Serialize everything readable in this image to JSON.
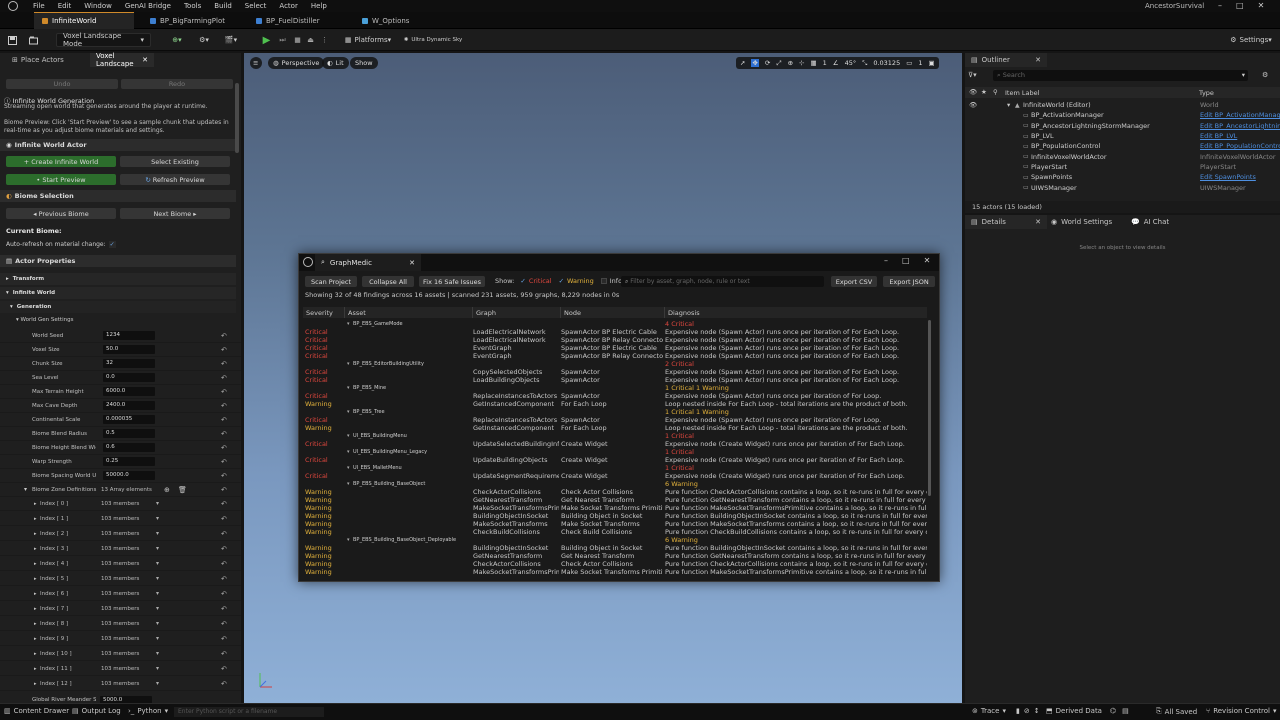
{
  "titlebar": {
    "menu": [
      "File",
      "Edit",
      "Window",
      "GenAI Bridge",
      "Tools",
      "Build",
      "Select",
      "Actor",
      "Help"
    ],
    "project": "AncestorSurvival"
  },
  "tabs": [
    {
      "label": "InfiniteWorld",
      "active": true
    },
    {
      "label": "BP_BigFarmingPlot",
      "active": false
    },
    {
      "label": "BP_FuelDistiller",
      "active": false
    },
    {
      "label": "W_Options",
      "active": false
    }
  ],
  "toolbar": {
    "mode": "Voxel Landscape Mode",
    "platforms": "Platforms",
    "sky": "Ultra Dynamic Sky",
    "settings": "Settings"
  },
  "left": {
    "tabs": [
      "Place Actors",
      "Voxel Landscape"
    ],
    "undo": "Undo",
    "redo": "Redo",
    "title": "Infinite World Generation",
    "subtitle": "Streaming open world that generates around the player at runtime.",
    "preview_note": "Biome Preview: Click 'Start Preview' to see a sample chunk that updates in real-time as you adjust biome materials and settings.",
    "actor_section": "Infinite World Actor",
    "create_btn": "+ Create Infinite World",
    "select_btn": "Select Existing",
    "start_btn": "• Start Preview",
    "refresh_btn": "Refresh Preview",
    "biome_section": "Biome Selection",
    "prev_btn": "◂ Previous Biome",
    "next_btn": "Next Biome ▸",
    "current_biome": "Current Biome:",
    "auto_refresh": "Auto-refresh on material change:",
    "actor_props": "Actor Properties",
    "transform": "Transform",
    "infinite_world": "Infinite World",
    "generation": "Generation",
    "world_gen_settings": "World Gen Settings",
    "props": [
      {
        "label": "World Seed",
        "value": "1234"
      },
      {
        "label": "Voxel Size",
        "value": "50.0"
      },
      {
        "label": "Chunk Size",
        "value": "32"
      },
      {
        "label": "Sea Level",
        "value": "0.0"
      },
      {
        "label": "Max Terrain Height",
        "value": "6000.0"
      },
      {
        "label": "Max Cave Depth",
        "value": "2400.0"
      },
      {
        "label": "Continental Scale",
        "value": "0.000035"
      },
      {
        "label": "Biome Blend Radius",
        "value": "0.5"
      },
      {
        "label": "Biome Height Blend Wid...",
        "value": "0.6"
      },
      {
        "label": "Warp Strength",
        "value": "0.25"
      },
      {
        "label": "Biome Spacing World U...",
        "value": "50000.0"
      }
    ],
    "zone_defs": {
      "label": "Biome Zone Definitions",
      "value": "13 Array elements"
    },
    "indices": [
      {
        "label": "Index [ 0 ]",
        "value": "103 members"
      },
      {
        "label": "Index [ 1 ]",
        "value": "103 members"
      },
      {
        "label": "Index [ 2 ]",
        "value": "103 members"
      },
      {
        "label": "Index [ 3 ]",
        "value": "103 members"
      },
      {
        "label": "Index [ 4 ]",
        "value": "103 members"
      },
      {
        "label": "Index [ 5 ]",
        "value": "103 members"
      },
      {
        "label": "Index [ 6 ]",
        "value": "103 members"
      },
      {
        "label": "Index [ 7 ]",
        "value": "103 members"
      },
      {
        "label": "Index [ 8 ]",
        "value": "103 members"
      },
      {
        "label": "Index [ 9 ]",
        "value": "103 members"
      },
      {
        "label": "Index [ 10 ]",
        "value": "103 members"
      },
      {
        "label": "Index [ 11 ]",
        "value": "103 members"
      },
      {
        "label": "Index [ 12 ]",
        "value": "103 members"
      }
    ],
    "river": {
      "label": "Global River Meander S...",
      "value": "5000.0"
    }
  },
  "viewport": {
    "perspective": "Perspective",
    "lit": "Lit",
    "show": "Show",
    "angle": "45°",
    "scale": "0.03125",
    "grid": "1",
    "cam": "1"
  },
  "outliner": {
    "tab": "Outliner",
    "search": "Search",
    "col_label": "Item Label",
    "col_type": "Type",
    "rows": [
      {
        "label": "InfiniteWorld (Editor)",
        "type": "World",
        "link": false
      },
      {
        "label": "BP_ActivationManager",
        "type": "Edit BP_ActivationManager",
        "link": true
      },
      {
        "label": "BP_AncestorLightningStormManager",
        "type": "Edit BP_AncestorLightning",
        "link": true
      },
      {
        "label": "BP_LVL",
        "type": "Edit BP_LVL",
        "link": true
      },
      {
        "label": "BP_PopulationControl",
        "type": "Edit BP_PopulationControl",
        "link": true
      },
      {
        "label": "InfiniteVoxelWorldActor",
        "type": "InfiniteVoxelWorldActor",
        "link": false
      },
      {
        "label": "PlayerStart",
        "type": "PlayerStart",
        "link": false
      },
      {
        "label": "SpawnPoints",
        "type": "Edit SpawnPoints",
        "link": true
      },
      {
        "label": "UIWSManager",
        "type": "UIWSManager",
        "link": false
      }
    ],
    "count": "15 actors (15 loaded)"
  },
  "details": {
    "tabs": [
      "Details",
      "World Settings",
      "AI Chat"
    ],
    "empty": "Select an object to view details"
  },
  "status": {
    "content_drawer": "Content Drawer",
    "output_log": "Output Log",
    "python": "Python",
    "cmd_placeholder": "Enter Python script or a filename",
    "trace": "Trace",
    "derived": "Derived Data",
    "saved": "All Saved",
    "revision": "Revision Control"
  },
  "graphmedic": {
    "title": "GraphMedic",
    "scan": "Scan Project",
    "collapse": "Collapse All",
    "fix": "Fix 16 Safe Issues",
    "show": "Show:",
    "critical": "Critical",
    "warning": "Warning",
    "info": "Info",
    "filter_placeholder": "Filter by asset, graph, node, rule or text",
    "export_csv": "Export CSV",
    "export_json": "Export JSON",
    "summary": "Showing 32 of 48 findings across 16 assets  |  scanned 231 assets, 959 graphs, 8,229 nodes in 0s",
    "headers": [
      "Severity",
      "Asset",
      "Graph",
      "Node",
      "Diagnosis"
    ],
    "rows": [
      {
        "sev": "",
        "asset": "BP_EBS_GameMode",
        "graph": "",
        "node": "",
        "diag": "4 Critical",
        "kind": "group-c"
      },
      {
        "sev": "Critical",
        "asset": "",
        "graph": "LoadElectricalNetwork",
        "node": "SpawnActor BP Electric Cable",
        "diag": "Expensive node (Spawn Actor) runs once per iteration of For Each Loop.",
        "kind": "c"
      },
      {
        "sev": "Critical",
        "asset": "",
        "graph": "LoadElectricalNetwork",
        "node": "SpawnActor BP Relay Connector",
        "diag": "Expensive node (Spawn Actor) runs once per iteration of For Each Loop.",
        "kind": "c"
      },
      {
        "sev": "Critical",
        "asset": "",
        "graph": "EventGraph",
        "node": "SpawnActor BP Electric Cable",
        "diag": "Expensive node (Spawn Actor) runs once per iteration of For Each Loop.",
        "kind": "c"
      },
      {
        "sev": "Critical",
        "asset": "",
        "graph": "EventGraph",
        "node": "SpawnActor BP Relay Connector",
        "diag": "Expensive node (Spawn Actor) runs once per iteration of For Each Loop.",
        "kind": "c"
      },
      {
        "sev": "",
        "asset": "BP_EBS_EditorBuildingUtility",
        "graph": "",
        "node": "",
        "diag": "2 Critical",
        "kind": "group-c"
      },
      {
        "sev": "Critical",
        "asset": "",
        "graph": "CopySelectedObjects",
        "node": "SpawnActor",
        "diag": "Expensive node (Spawn Actor) runs once per iteration of For Each Loop.",
        "kind": "c"
      },
      {
        "sev": "Critical",
        "asset": "",
        "graph": "LoadBuildingObjects",
        "node": "SpawnActor",
        "diag": "Expensive node (Spawn Actor) runs once per iteration of For Each Loop.",
        "kind": "c"
      },
      {
        "sev": "",
        "asset": "BP_EBS_Mine",
        "graph": "",
        "node": "",
        "diag": "1 Critical    1 Warning",
        "kind": "group-cw"
      },
      {
        "sev": "Critical",
        "asset": "",
        "graph": "ReplaceInstancesToActors",
        "node": "SpawnActor",
        "diag": "Expensive node (Spawn Actor) runs once per iteration of For Loop.",
        "kind": "c"
      },
      {
        "sev": "Warning",
        "asset": "",
        "graph": "GetInstancedComponent",
        "node": "For Each Loop",
        "diag": "Loop nested inside For Each Loop - total iterations are the product of both.",
        "kind": "w"
      },
      {
        "sev": "",
        "asset": "BP_EBS_Tree",
        "graph": "",
        "node": "",
        "diag": "1 Critical    1 Warning",
        "kind": "group-cw"
      },
      {
        "sev": "Critical",
        "asset": "",
        "graph": "ReplaceInstancesToActors",
        "node": "SpawnActor",
        "diag": "Expensive node (Spawn Actor) runs once per iteration of For Loop.",
        "kind": "c"
      },
      {
        "sev": "Warning",
        "asset": "",
        "graph": "GetInstancedComponent",
        "node": "For Each Loop",
        "diag": "Loop nested inside For Each Loop - total iterations are the product of both.",
        "kind": "w"
      },
      {
        "sev": "",
        "asset": "UI_EBS_BuildingMenu",
        "graph": "",
        "node": "",
        "diag": "1 Critical",
        "kind": "group-c"
      },
      {
        "sev": "Critical",
        "asset": "",
        "graph": "UpdateSelectedBuildingInfo",
        "node": "Create Widget",
        "diag": "Expensive node (Create Widget) runs once per iteration of For Each Loop.",
        "kind": "c"
      },
      {
        "sev": "",
        "asset": "UI_EBS_BuildingMenu_Legacy",
        "graph": "",
        "node": "",
        "diag": "1 Critical",
        "kind": "group-c"
      },
      {
        "sev": "Critical",
        "asset": "",
        "graph": "UpdateBuildingObjects",
        "node": "Create Widget",
        "diag": "Expensive node (Create Widget) runs once per iteration of For Each Loop.",
        "kind": "c"
      },
      {
        "sev": "",
        "asset": "UI_EBS_MalletMenu",
        "graph": "",
        "node": "",
        "diag": "1 Critical",
        "kind": "group-c"
      },
      {
        "sev": "Critical",
        "asset": "",
        "graph": "UpdateSegmentRequirements",
        "node": "Create Widget",
        "diag": "Expensive node (Create Widget) runs once per iteration of For Each Loop.",
        "kind": "c"
      },
      {
        "sev": "",
        "asset": "BP_EBS_Building_BaseObject",
        "graph": "",
        "node": "",
        "diag": "6 Warning",
        "kind": "group-w"
      },
      {
        "sev": "Warning",
        "asset": "",
        "graph": "CheckActorCollisions",
        "node": "Check Actor Collisions",
        "diag": "Pure function CheckActorCollisions contains a loop, so it re-runs in full for every output p",
        "kind": "w"
      },
      {
        "sev": "Warning",
        "asset": "",
        "graph": "GetNearestTransform",
        "node": "Get Nearest Transform",
        "diag": "Pure function GetNearestTransform contains a loop, so it re-runs in full for every output p",
        "kind": "w"
      },
      {
        "sev": "Warning",
        "asset": "",
        "graph": "MakeSocketTransformsPrimitive",
        "node": "Make Socket Transforms Primitive",
        "diag": "Pure function MakeSocketTransformsPrimitive contains a loop, so it re-runs in full for ev",
        "kind": "w"
      },
      {
        "sev": "Warning",
        "asset": "",
        "graph": "BuildingObjectInSocket",
        "node": "Building Object in Socket",
        "diag": "Pure function BuildingObjectInSocket contains a loop, so it re-runs in full for every outp",
        "kind": "w"
      },
      {
        "sev": "Warning",
        "asset": "",
        "graph": "MakeSocketTransforms",
        "node": "Make Socket Transforms",
        "diag": "Pure function MakeSocketTransforms contains a loop, so it re-runs in full for every output",
        "kind": "w"
      },
      {
        "sev": "Warning",
        "asset": "",
        "graph": "CheckBuildCollisions",
        "node": "Check Build Collisions",
        "diag": "Pure function CheckBuildCollisions contains a loop, so it re-runs in full for every output p",
        "kind": "w"
      },
      {
        "sev": "",
        "asset": "BP_EBS_Building_BaseObject_Deployable",
        "graph": "",
        "node": "",
        "diag": "6 Warning",
        "kind": "group-w"
      },
      {
        "sev": "Warning",
        "asset": "",
        "graph": "BuildingObjectInSocket",
        "node": "Building Object in Socket",
        "diag": "Pure function BuildingObjectInSocket contains a loop, so it re-runs in full for every outp",
        "kind": "w"
      },
      {
        "sev": "Warning",
        "asset": "",
        "graph": "GetNearestTransform",
        "node": "Get Nearest Transform",
        "diag": "Pure function GetNearestTransform contains a loop, so it re-runs in full for every output p",
        "kind": "w"
      },
      {
        "sev": "Warning",
        "asset": "",
        "graph": "CheckActorCollisions",
        "node": "Check Actor Collisions",
        "diag": "Pure function CheckActorCollisions contains a loop, so it re-runs in full for every output p",
        "kind": "w"
      },
      {
        "sev": "Warning",
        "asset": "",
        "graph": "MakeSocketTransformsPrimitive",
        "node": "Make Socket Transforms Primitive",
        "diag": "Pure function MakeSocketTransformsPrimitive contains a loop, so it re-runs in full for ev",
        "kind": "w"
      }
    ]
  }
}
